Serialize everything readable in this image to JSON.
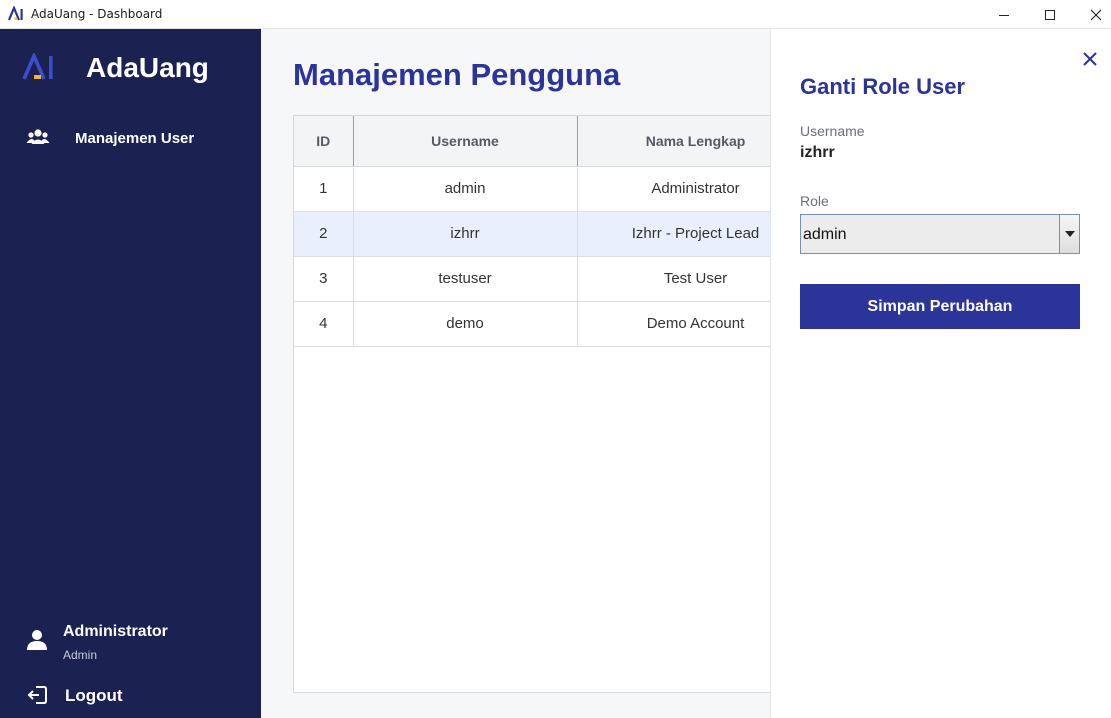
{
  "window": {
    "title": "AdaUang - Dashboard",
    "icon": "adauang-logo-icon"
  },
  "sidebar": {
    "brand": "AdaUang",
    "nav_items": [
      {
        "label": "Manajemen User",
        "icon": "users-icon"
      }
    ],
    "user": {
      "name": "Administrator",
      "role": "Admin",
      "icon": "user-icon"
    },
    "logout": {
      "label": "Logout",
      "icon": "logout-icon"
    }
  },
  "main": {
    "title": "Manajemen Pengguna",
    "table": {
      "columns": [
        "ID",
        "Username",
        "Nama Lengkap"
      ],
      "rows": [
        {
          "id": "1",
          "username": "admin",
          "full_name": "Administrator"
        },
        {
          "id": "2",
          "username": "izhrr",
          "full_name": "Izhrr - Project Lead"
        },
        {
          "id": "3",
          "username": "testuser",
          "full_name": "Test User"
        },
        {
          "id": "4",
          "username": "demo",
          "full_name": "Demo Account"
        }
      ],
      "selected_row": 2
    }
  },
  "panel": {
    "title": "Ganti Role User",
    "username_label": "Username",
    "username_value": "izhrr",
    "role_label": "Role",
    "role_value": "admin",
    "save_label": "Simpan Perubahan",
    "close_icon": "close-icon"
  },
  "colors": {
    "sidebar_bg": "#1b2151",
    "accent": "#2b3499",
    "logo_accent": "#f5b623",
    "selected_row": "#e9effc"
  }
}
